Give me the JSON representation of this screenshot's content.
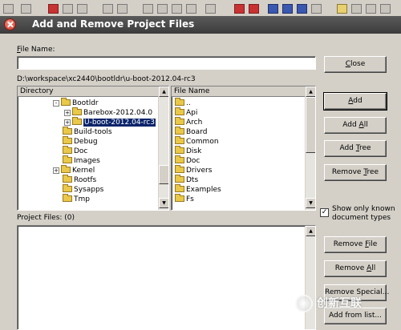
{
  "dialog": {
    "title": "Add and Remove Project Files",
    "file_name_label": "File Name:",
    "file_name_value": "",
    "path": "D:\\workspace\\xc2440\\bootldr\\u-boot-2012.04-rc3",
    "directory_header": "Directory",
    "file_name_header": "File Name",
    "project_files_label": "Project Files: (0)",
    "show_only_known_label_1": "Show only known",
    "show_only_known_label_2": "document types",
    "show_only_known_checked": true
  },
  "directory_tree": [
    {
      "label": "Bootldr",
      "expander": "-",
      "selected": false
    },
    {
      "label": "Barebox-2012.04.0",
      "expander": "+",
      "selected": false
    },
    {
      "label": "U-boot-2012.04-rc3",
      "expander": "+",
      "selected": true
    },
    {
      "label": "Build-tools",
      "expander": "",
      "selected": false
    },
    {
      "label": "Debug",
      "expander": "",
      "selected": false
    },
    {
      "label": "Doc",
      "expander": "",
      "selected": false
    },
    {
      "label": "Images",
      "expander": "",
      "selected": false
    },
    {
      "label": "Kernel",
      "expander": "+",
      "selected": false
    },
    {
      "label": "Rootfs",
      "expander": "",
      "selected": false
    },
    {
      "label": "Sysapps",
      "expander": "",
      "selected": false
    },
    {
      "label": "Tmp",
      "expander": "",
      "selected": false
    }
  ],
  "file_list": [
    "..",
    "Api",
    "Arch",
    "Board",
    "Common",
    "Disk",
    "Doc",
    "Drivers",
    "Dts",
    "Examples",
    "Fs"
  ],
  "buttons": {
    "close": "Close",
    "add": "Add",
    "add_all": "Add All",
    "add_tree": "Add Tree",
    "remove_tree": "Remove Tree",
    "remove_file": "Remove File",
    "remove_all": "Remove All",
    "remove_special": "Remove Special...",
    "add_from_list": "Add from list..."
  },
  "watermark": {
    "text": "创新互联"
  }
}
